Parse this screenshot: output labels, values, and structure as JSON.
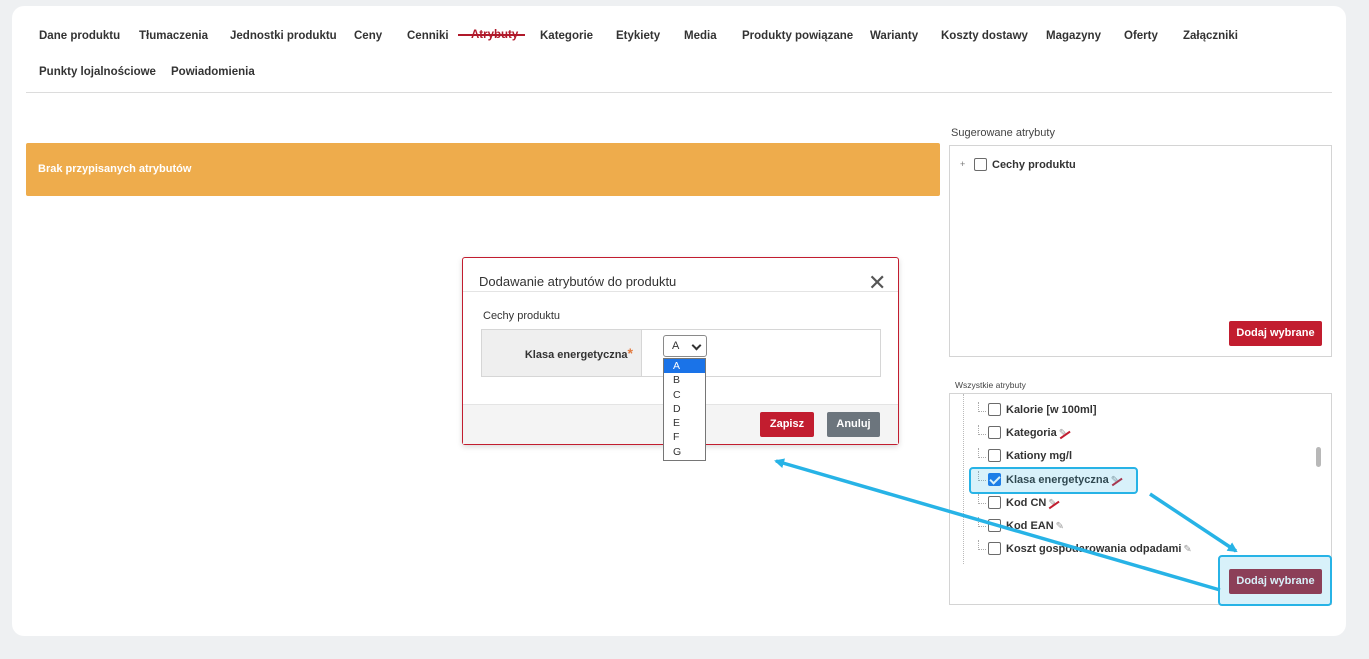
{
  "tabs": [
    {
      "label": "Dane produktu"
    },
    {
      "label": "Tłumaczenia"
    },
    {
      "label": "Jednostki produktu"
    },
    {
      "label": "Ceny"
    },
    {
      "label": "Cenniki"
    },
    {
      "label": "Atrybuty",
      "active": true
    },
    {
      "label": "Kategorie"
    },
    {
      "label": "Etykiety"
    },
    {
      "label": "Media"
    },
    {
      "label": "Produkty powiązane"
    },
    {
      "label": "Warianty"
    },
    {
      "label": "Koszty dostawy"
    },
    {
      "label": "Magazyny"
    },
    {
      "label": "Oferty"
    },
    {
      "label": "Załączniki"
    },
    {
      "label": "Punkty lojalnościowe"
    },
    {
      "label": "Powiadomienia"
    }
  ],
  "alert": {
    "text": "Brak przypisanych atrybutów"
  },
  "suggested": {
    "title": "Sugerowane atrybuty",
    "items": [
      {
        "label": "Cechy produktu",
        "checked": false
      }
    ],
    "add_button": "Dodaj wybrane"
  },
  "all_attributes": {
    "title": "Wszystkie atrybuty",
    "items": [
      {
        "label": "Kalorie [w 100ml]",
        "checked": false,
        "icon": ""
      },
      {
        "label": "Kategoria",
        "checked": false,
        "icon": "no-edit-icon"
      },
      {
        "label": "Kationy mg/l",
        "checked": false,
        "icon": ""
      },
      {
        "label": "Klasa energetyczna",
        "checked": true,
        "icon": "no-edit-icon"
      },
      {
        "label": "Kod CN",
        "checked": false,
        "icon": "no-edit-icon"
      },
      {
        "label": "Kod EAN",
        "checked": false,
        "icon": "edit-icon"
      },
      {
        "label": "Koszt gospodarowania odpadami",
        "checked": false,
        "icon": "edit-icon"
      }
    ],
    "add_button": "Dodaj wybrane"
  },
  "modal": {
    "title": "Dodawanie atrybutów do produktu",
    "close_glyph": "✕",
    "section": "Cechy produktu",
    "field_label": "Klasa energetyczna",
    "required_mark": "*",
    "select_value": "A",
    "options": [
      "A",
      "B",
      "C",
      "D",
      "E",
      "F",
      "G"
    ],
    "save_button": "Zapisz",
    "cancel_button": "Anuluj"
  },
  "colors": {
    "accent": "#b0192a",
    "alert": "#eeac4c",
    "highlight": "#27b3e6"
  }
}
